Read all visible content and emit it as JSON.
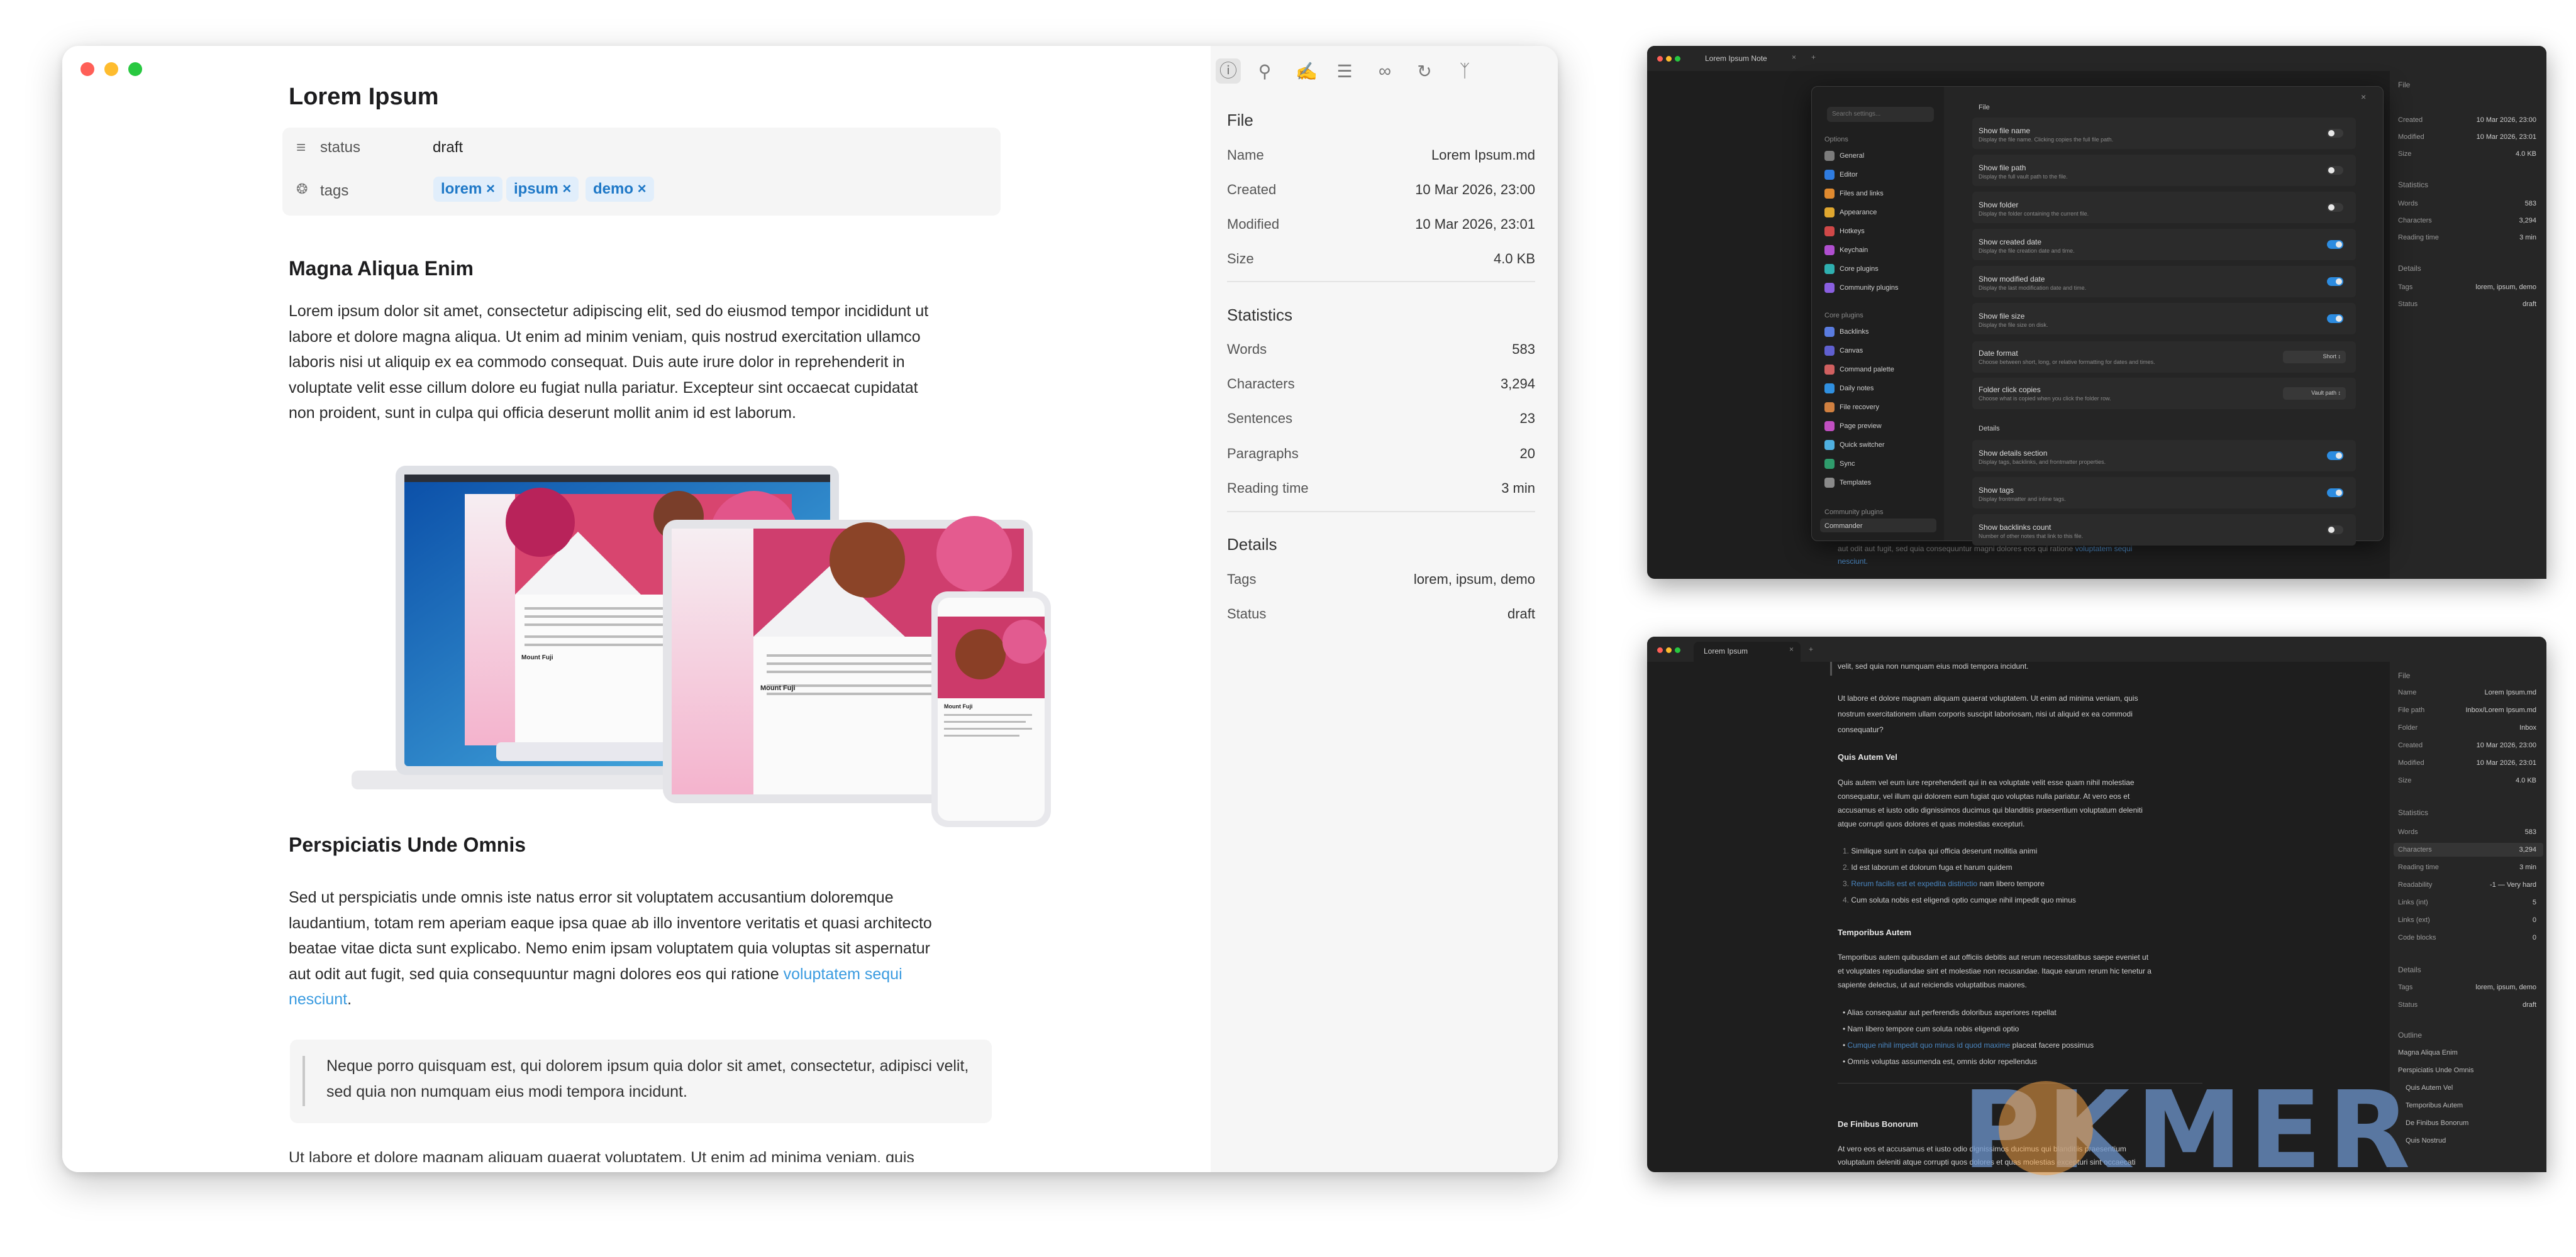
{
  "main_window": {
    "doc_title": "Lorem Ipsum",
    "properties": [
      {
        "key": "status",
        "value": "draft"
      },
      {
        "key": "tags",
        "tags": [
          "lorem",
          "ipsum",
          "demo"
        ]
      }
    ],
    "sections": [
      {
        "heading": "Magna Aliqua Enim"
      },
      {
        "heading": "Perspiciatis Unde Omnis"
      }
    ],
    "para1": [
      "Lorem ipsum dolor sit amet, consectetur adipiscing elit, sed do eiusmod tempor incididunt ut",
      "labore et dolore magna aliqua. Ut enim ad minim veniam, quis nostrud exercitation ullamco",
      "laboris nisi ut aliquip ex ea commodo consequat. Duis aute irure dolor in reprehenderit in",
      "voluptate velit esse cillum dolore eu fugiat nulla pariatur. Excepteur sint occaecat cupidatat",
      "non proident, sunt in culpa qui officia deserunt mollit anim id est laborum."
    ],
    "para2": [
      "Sed ut perspiciatis unde omnis iste natus error sit voluptatem accusantium doloremque",
      "laudantium, totam rem aperiam eaque ipsa quae ab illo inventore veritatis et quasi architecto",
      "beatae vitae dicta sunt explicabo. Nemo enim ipsam voluptatem quia voluptas sit aspernatur",
      "aut odit aut fugit, sed quia consequuntur magni dolores eos qui ratione"
    ],
    "para2_link": [
      "voluptatem sequi",
      "nesciunt"
    ],
    "para2_end": ".",
    "quote": "Neque porro quisquam est, qui dolorem ipsum quia dolor sit amet, consectetur, adipisci velit, sed quia non numquam eius modi tempora incidunt.",
    "cut_line": "Ut labore et dolore magnam aliquam quaerat voluptatem. Ut enim ad minima veniam, quis",
    "image_caption": "Mount Fuji",
    "info_panel": {
      "toolbar_icons": [
        "info-icon",
        "search-icon",
        "signature-icon",
        "list-icon",
        "link-icon",
        "backlink-icon",
        "graph-icon"
      ],
      "file": {
        "title": "File",
        "rows": [
          {
            "k": "Name",
            "v": "Lorem Ipsum.md"
          },
          {
            "k": "Created",
            "v": "10 Mar 2026, 23:00"
          },
          {
            "k": "Modified",
            "v": "10 Mar 2026, 23:01"
          },
          {
            "k": "Size",
            "v": "4.0 KB"
          }
        ]
      },
      "stats": {
        "title": "Statistics",
        "rows": [
          {
            "k": "Words",
            "v": "583"
          },
          {
            "k": "Characters",
            "v": "3,294"
          },
          {
            "k": "Sentences",
            "v": "23"
          },
          {
            "k": "Paragraphs",
            "v": "20"
          },
          {
            "k": "Reading time",
            "v": "3 min"
          }
        ]
      },
      "details": {
        "title": "Details",
        "rows": [
          {
            "k": "Tags",
            "v": "lorem, ipsum, demo"
          },
          {
            "k": "Status",
            "v": "draft"
          }
        ]
      }
    }
  },
  "settings_window": {
    "tab_title": "Lorem Ipsum Note",
    "search_placeholder": "Search settings...",
    "options_header": "Options",
    "nav_options": [
      "General",
      "Editor",
      "Files and links",
      "Appearance",
      "Hotkeys",
      "Keychain",
      "Core plugins",
      "Community plugins"
    ],
    "core_header": "Core plugins",
    "nav_core": [
      "Backlinks",
      "Canvas",
      "Command palette",
      "Daily notes",
      "File recovery",
      "Page preview",
      "Quick switcher",
      "Sync",
      "Templates"
    ],
    "community_header": "Community plugins",
    "nav_community": [
      "Commander"
    ],
    "file_header": "File",
    "file_rows": [
      {
        "t": "Show file name",
        "d": "Display the file name. Clicking copies the full file path.",
        "on": false
      },
      {
        "t": "Show file path",
        "d": "Display the full vault path to the file.",
        "on": false
      },
      {
        "t": "Show folder",
        "d": "Display the folder containing the current file.",
        "on": false
      },
      {
        "t": "Show created date",
        "d": "Display the file creation date and time.",
        "on": true
      },
      {
        "t": "Show modified date",
        "d": "Display the last modification date and time.",
        "on": true
      },
      {
        "t": "Show file size",
        "d": "Display the file size on disk.",
        "on": true
      }
    ],
    "date_format": {
      "t": "Date format",
      "d": "Choose between short, long, or relative formatting for dates and times.",
      "value": "Short"
    },
    "folder_click": {
      "t": "Folder click copies",
      "d": "Choose what is copied when you click the folder row.",
      "value": "Vault path"
    },
    "details_header": "Details",
    "detail_rows": [
      {
        "t": "Show details section",
        "d": "Display tags, backlinks, and frontmatter properties.",
        "on": true
      },
      {
        "t": "Show tags",
        "d": "Display frontmatter and inline tags.",
        "on": true
      },
      {
        "t": "Show backlinks count",
        "d": "Number of other notes that link to this file.",
        "on": false
      }
    ],
    "behind_text": [
      "aut odit aut fugit, sed quia consequuntur magni dolores eos qui ratione",
      "nesciunt."
    ],
    "behind_link": "voluptatem sequi",
    "side": {
      "file_title": "File",
      "file_rows": [
        {
          "k": "Created",
          "v": "10 Mar 2026, 23:00"
        },
        {
          "k": "Modified",
          "v": "10 Mar 2026, 23:01"
        },
        {
          "k": "Size",
          "v": "4.0 KB"
        }
      ],
      "stats_title": "Statistics",
      "stats_rows": [
        {
          "k": "Words",
          "v": "583"
        },
        {
          "k": "Characters",
          "v": "3,294"
        },
        {
          "k": "Reading time",
          "v": "3 min"
        }
      ],
      "details_title": "Details",
      "details_rows": [
        {
          "k": "Tags",
          "v": "lorem, ipsum, demo"
        },
        {
          "k": "Status",
          "v": "draft"
        }
      ]
    }
  },
  "dark_window": {
    "tab_title": "Lorem Ipsum",
    "top_cut": "velit, sed quia non numquam eius modi tempora incidunt.",
    "para_a": [
      "Ut labore et dolore magnam aliquam quaerat voluptatem. Ut enim ad minima veniam, quis",
      "nostrum exercitationem ullam corporis suscipit laboriosam, nisi ut aliquid ex ea commodi",
      "consequatur?"
    ],
    "h_quis": "Quis Autem Vel",
    "para_b": [
      "Quis autem vel eum iure reprehenderit qui in ea voluptate velit esse quam nihil molestiae",
      "consequatur, vel illum qui dolorem eum fugiat quo voluptas nulla pariatur. At vero eos et",
      "accusamus et iusto odio dignissimos ducimus qui blanditiis praesentium voluptatum deleniti",
      "atque corrupti quos dolores et quas molestias excepturi."
    ],
    "list_a": [
      {
        "n": "1.",
        "t": "Similique sunt in culpa qui officia deserunt mollitia animi"
      },
      {
        "n": "2.",
        "t": "Id est laborum et dolorum fuga et harum quidem"
      },
      {
        "n": "3.",
        "link": "Rerum facilis est et expedita distinctio",
        "t": " nam libero tempore"
      },
      {
        "n": "4.",
        "t": "Cum soluta nobis est eligendi optio cumque nihil impedit quo minus"
      }
    ],
    "h_temp": "Temporibus Autem",
    "para_c": [
      "Temporibus autem quibusdam et aut officiis debitis aut rerum necessitatibus saepe eveniet ut",
      "et voluptates repudiandae sint et molestiae non recusandae. Itaque earum rerum hic tenetur a",
      "sapiente delectus, ut aut reiciendis voluptatibus maiores."
    ],
    "list_b": [
      {
        "t": "Alias consequatur aut perferendis doloribus asperiores repellat"
      },
      {
        "t": "Nam libero tempore cum soluta nobis eligendi optio"
      },
      {
        "link": "Cumque nihil impedit quo minus id quod maxime",
        "t": " placeat facere possimus"
      },
      {
        "t": "Omnis voluptas assumenda est, omnis dolor repellendus"
      }
    ],
    "h_finibus": "De Finibus Bonorum",
    "para_d": [
      "At vero eos et accusamus et iusto odio dignissimos ducimus qui blanditiis praesentium",
      "voluptatum deleniti atque corrupti quos dolores et quas molestias excepturi sint occaecati"
    ],
    "side": {
      "file_title": "File",
      "file_rows": [
        {
          "k": "Name",
          "v": "Lorem Ipsum.md"
        },
        {
          "k": "File path",
          "v": "Inbox/Lorem Ipsum.md"
        },
        {
          "k": "Folder",
          "v": "Inbox"
        },
        {
          "k": "Created",
          "v": "10 Mar 2026, 23:00"
        },
        {
          "k": "Modified",
          "v": "10 Mar 2026, 23:01"
        },
        {
          "k": "Size",
          "v": "4.0 KB"
        }
      ],
      "stats_title": "Statistics",
      "stats_rows": [
        {
          "k": "Words",
          "v": "583"
        },
        {
          "k": "Characters",
          "v": "3,294"
        },
        {
          "k": "Reading time",
          "v": "3 min"
        },
        {
          "k": "Readability",
          "v": "-1 — Very hard"
        },
        {
          "k": "Links (int)",
          "v": "5"
        },
        {
          "k": "Links (ext)",
          "v": "0"
        },
        {
          "k": "Code blocks",
          "v": "0"
        }
      ],
      "details_title": "Details",
      "details_rows": [
        {
          "k": "Tags",
          "v": "lorem, ipsum, demo"
        },
        {
          "k": "Status",
          "v": "draft"
        }
      ],
      "outline_title": "Outline",
      "outline": [
        "Magna Aliqua Enim",
        "Perspiciatis Unde Omnis",
        "Quis Autem Vel",
        "Temporibus Autem",
        "De Finibus Bonorum",
        "Quis Nostrud"
      ]
    }
  },
  "watermark": "PKMER",
  "colors": {
    "tag_text": "#1e78c7",
    "tag_bg": "#e1eefb",
    "link": "#3a9be0",
    "toggle_on": "#2d8ce0",
    "close": "#ff5f57",
    "minimize": "#febc2e",
    "zoom": "#28c840"
  }
}
